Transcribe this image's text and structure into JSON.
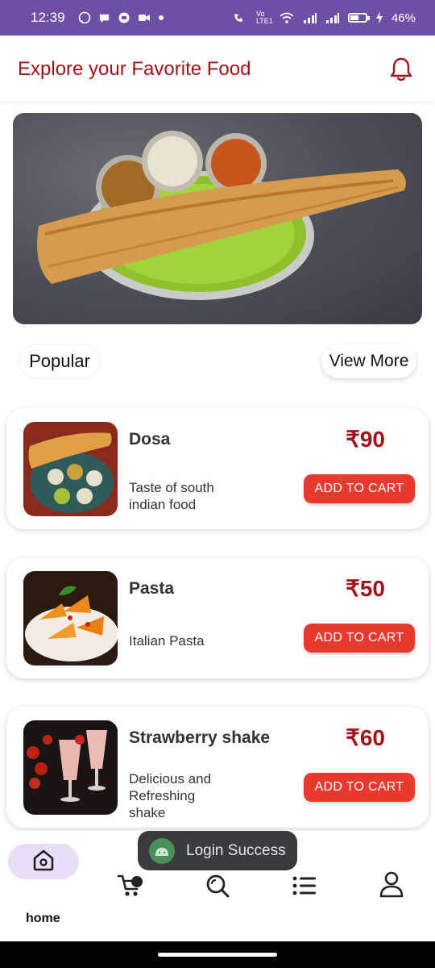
{
  "status_bar": {
    "time": "12:39",
    "battery_percent": "46%",
    "network_label": "Vo LTE1"
  },
  "header": {
    "title": "Explore your Favorite Food",
    "notification_icon": "bell-icon"
  },
  "banner": {
    "image": "dosa-thali-photo"
  },
  "section": {
    "popular_label": "Popular",
    "view_more_label": "View More"
  },
  "food_items": [
    {
      "name": "Dosa",
      "description": "Taste of south indian food",
      "price": "₹90",
      "button_label": "ADD TO CART"
    },
    {
      "name": "Pasta",
      "description": "Italian Pasta",
      "price": "₹50",
      "button_label": "ADD TO CART"
    },
    {
      "name": "Strawberry shake",
      "description": "Delicious and Refreshing shake",
      "price": "₹60",
      "button_label": "ADD TO CART"
    }
  ],
  "toast": {
    "message": "Login Success"
  },
  "bottom_nav": {
    "home_label": "home",
    "items": [
      "home-icon",
      "cart-icon",
      "search-icon",
      "list-icon",
      "profile-icon"
    ]
  },
  "colors": {
    "status_bar": "#6e4fa6",
    "title_red": "#a1141a",
    "button_red": "#e8392f",
    "nav_active_bg": "#e8def8"
  }
}
